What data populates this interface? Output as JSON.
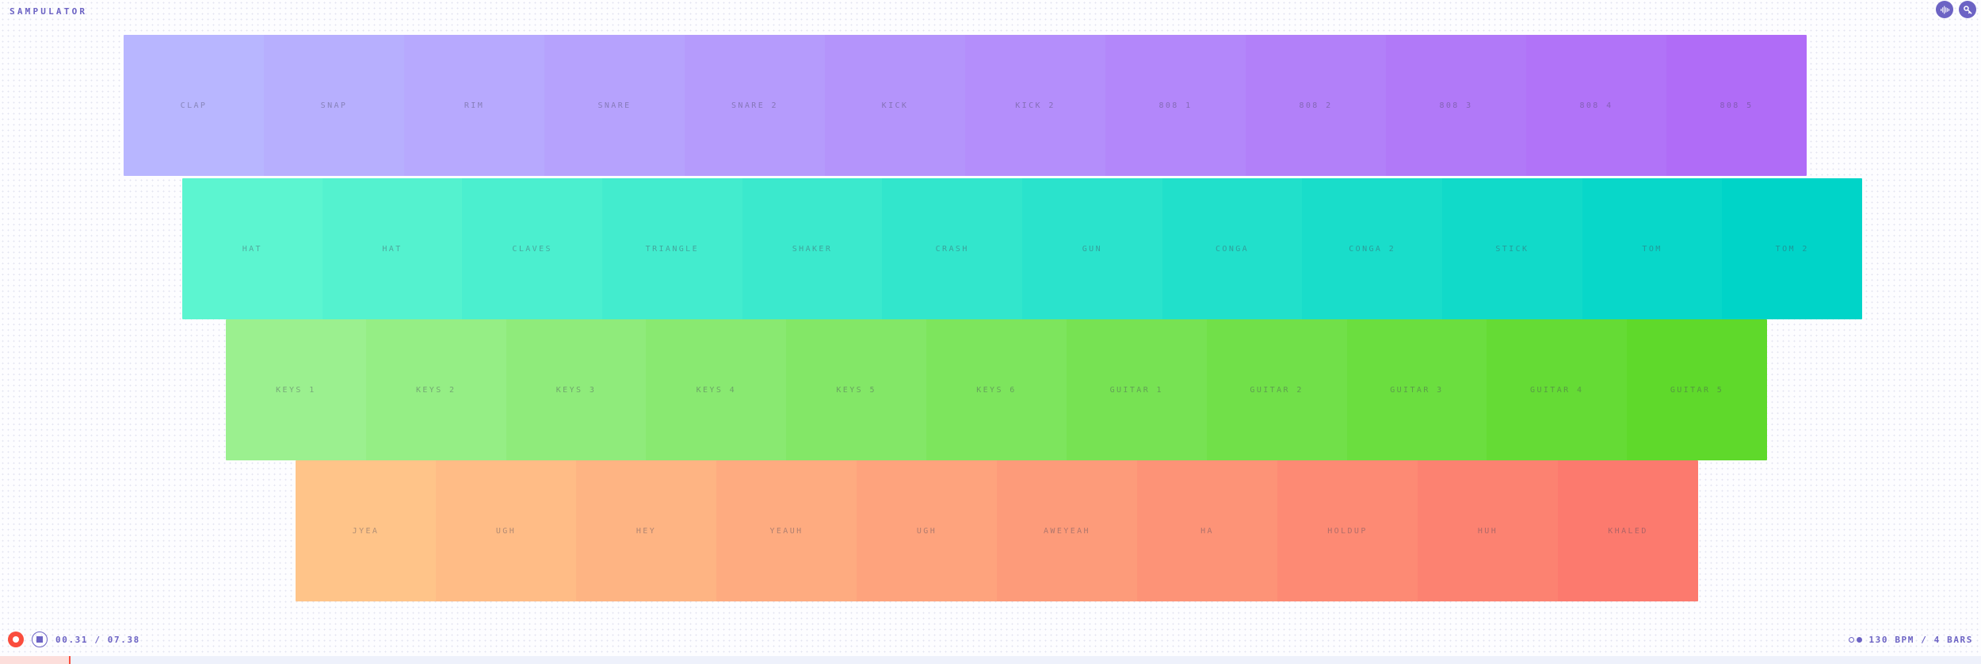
{
  "app": {
    "title": "SAMPULATOR",
    "accent": "#6c63c4",
    "record_color": "#fa4d3d",
    "background": "#fdfdff"
  },
  "header": {
    "buttons": [
      {
        "name": "waveform-icon",
        "label": "Waveform"
      },
      {
        "name": "key-icon",
        "label": "Keyboard shortcuts"
      }
    ]
  },
  "board": {
    "rows": [
      {
        "id": "drums",
        "start_color": "#b8b6ff",
        "end_color": "#b06cf7",
        "pads": [
          {
            "label": "CLAP"
          },
          {
            "label": "SNAP"
          },
          {
            "label": "RIM"
          },
          {
            "label": "SNARE"
          },
          {
            "label": "SNARE 2"
          },
          {
            "label": "KICK"
          },
          {
            "label": "KICK 2"
          },
          {
            "label": "808 1"
          },
          {
            "label": "808 2"
          },
          {
            "label": "808 3"
          },
          {
            "label": "808 4"
          },
          {
            "label": "808 5"
          }
        ]
      },
      {
        "id": "percussion",
        "start_color": "#5cf5d0",
        "end_color": "#00d4c8",
        "pads": [
          {
            "label": "HAT"
          },
          {
            "label": "HAT"
          },
          {
            "label": "CLAVES"
          },
          {
            "label": "TRIANGLE"
          },
          {
            "label": "SHAKER"
          },
          {
            "label": "CRASH"
          },
          {
            "label": "GUN"
          },
          {
            "label": "CONGA"
          },
          {
            "label": "CONGA 2"
          },
          {
            "label": "STICK"
          },
          {
            "label": "TOM"
          },
          {
            "label": "TOM 2"
          }
        ]
      },
      {
        "id": "melodic",
        "start_color": "#9bf08f",
        "end_color": "#5fd92b",
        "pads": [
          {
            "label": "KEYS 1"
          },
          {
            "label": "KEYS 2"
          },
          {
            "label": "KEYS 3"
          },
          {
            "label": "KEYS 4"
          },
          {
            "label": "KEYS 5"
          },
          {
            "label": "KEYS 6"
          },
          {
            "label": "GUITAR 1"
          },
          {
            "label": "GUITAR 2"
          },
          {
            "label": "GUITAR 3"
          },
          {
            "label": "GUITAR 4"
          },
          {
            "label": "GUITAR 5"
          }
        ]
      },
      {
        "id": "vocals",
        "start_color": "#ffc489",
        "end_color": "#fc7a6e",
        "pads": [
          {
            "label": "JYEA"
          },
          {
            "label": "UGH"
          },
          {
            "label": "HEY"
          },
          {
            "label": "YEAUH"
          },
          {
            "label": "UGH"
          },
          {
            "label": "AWEYEAH"
          },
          {
            "label": "HA"
          },
          {
            "label": "HOLDUP"
          },
          {
            "label": "HUH"
          },
          {
            "label": "KHALED"
          }
        ]
      }
    ]
  },
  "transport": {
    "record_label": "Record",
    "stop_label": "Stop",
    "time": "00.31 / 07.38",
    "tempo": "130 BPM / 4 BARS",
    "loop_label": "Loop"
  },
  "progress": {
    "percent": 3.5
  }
}
